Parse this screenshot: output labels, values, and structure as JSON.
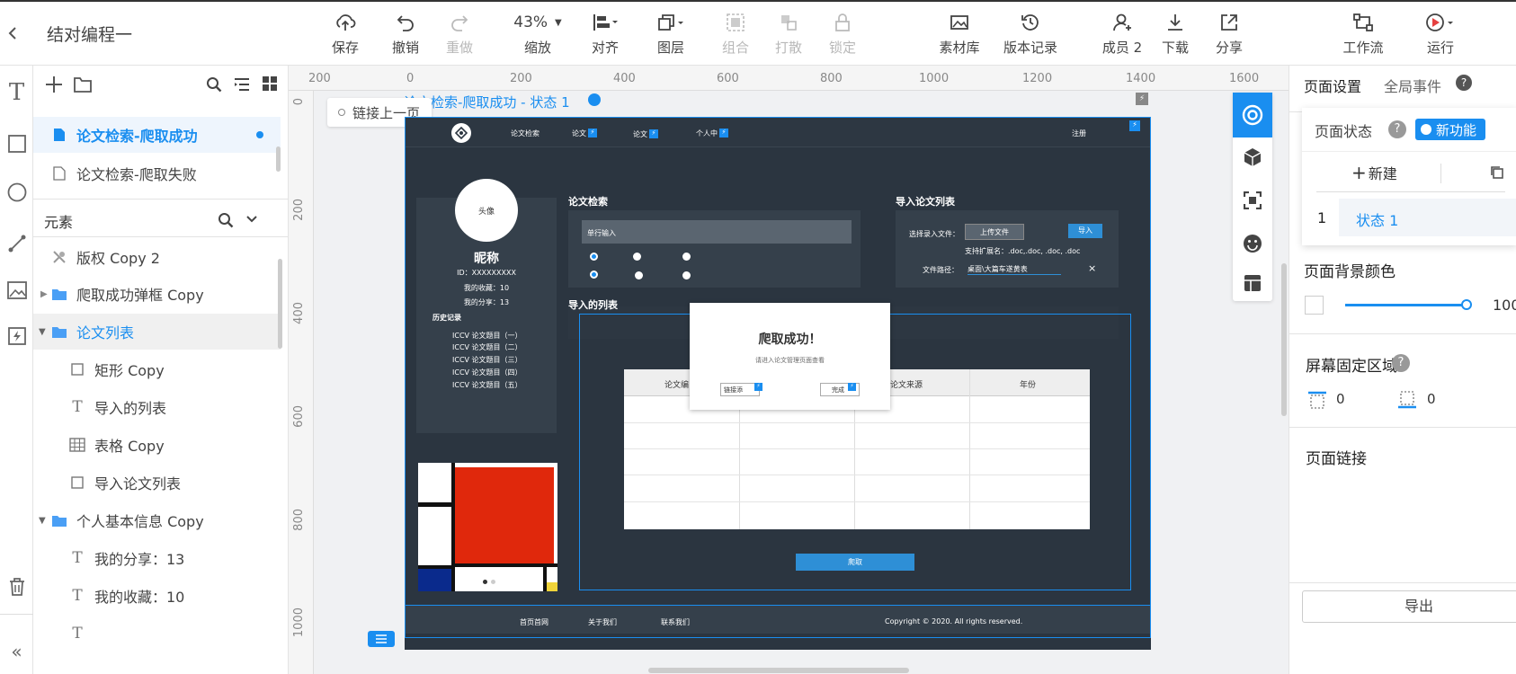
{
  "app": {
    "title": "结对编程一"
  },
  "toolbar": {
    "save": "保存",
    "undo": "撤销",
    "redo": "重做",
    "zoom": "43%",
    "zoom_label": "缩放",
    "align": "对齐",
    "layers": "图层",
    "group": "组合",
    "ungroup": "打散",
    "lock": "锁定",
    "assets": "素材库",
    "history": "版本记录",
    "members": "成员 2",
    "download": "下载",
    "share": "分享",
    "workflow": "工作流",
    "run": "运行"
  },
  "pages": [
    {
      "label": "论文检索-爬取成功",
      "active": true
    },
    {
      "label": "论文检索-爬取失败",
      "active": false
    }
  ],
  "elements_header": "元素",
  "tree": [
    {
      "label": "版权 Copy 2",
      "icon": "copyright-widget-icon"
    },
    {
      "label": "爬取成功弹框 Copy",
      "icon": "folder-icon"
    },
    {
      "label": "论文列表",
      "icon": "folder-icon"
    },
    {
      "label": "矩形 Copy",
      "icon": "rectangle-icon"
    },
    {
      "label": "导入的列表",
      "icon": "text-icon"
    },
    {
      "label": "表格 Copy",
      "icon": "table-icon"
    },
    {
      "label": "导入论文列表",
      "icon": "rectangle-icon"
    },
    {
      "label": "个人基本信息 Copy",
      "icon": "folder-icon"
    },
    {
      "label": "我的分享：13",
      "icon": "text-icon"
    },
    {
      "label": "我的收藏：10",
      "icon": "text-icon"
    }
  ],
  "ruler": {
    "top": [
      "200",
      "0",
      "200",
      "400",
      "600",
      "800",
      "1000",
      "1200",
      "1400",
      "1600"
    ],
    "left": [
      "0",
      "200",
      "400",
      "600",
      "800",
      "1000"
    ]
  },
  "canvas": {
    "state_label": "论文检索-爬取成功 - 状态 1",
    "link_prev": "链接上一页"
  },
  "mock": {
    "nav": [
      "论文检索",
      "论文",
      "论文",
      "个人中"
    ],
    "register": "注册",
    "avatar": "头像",
    "nickname": "昵称",
    "id": "ID：XXXXXXXXX",
    "favorites": "我的收藏：10",
    "shares": "我的分享：13",
    "history_title": "历史记录",
    "history": [
      "ICCV 论文题目（一）",
      "ICCV 论文题目（二）",
      "ICCV 论文题目（三）",
      "ICCV 论文题目（四）",
      "ICCV 论文题目（五）"
    ],
    "search_title": "论文检索",
    "search_placeholder": "单行输入",
    "import_title": "导入论文列表",
    "choose_file": "选择录入文件：",
    "upload": "上传文件",
    "import_btn": "导入",
    "ext": "支持扩展名：.doc,.doc, .doc, .doc",
    "path_label": "文件路径：",
    "path_value": "桌面\\大篇车遂黄表",
    "list_title": "导入的列表",
    "table_headers": [
      "论文编",
      "",
      "论文来源",
      "年份"
    ],
    "crawl_btn": "爬取",
    "popup_title": "爬取成功！",
    "popup_msg": "请进入论文管理页面查看",
    "popup_link": "链接添",
    "popup_done": "完成",
    "footer_links": [
      "首页首网",
      "关于我们",
      "联系我们"
    ],
    "copyright": "Copyright © 2020. All rights reserved."
  },
  "right": {
    "tab_page": "页面设置",
    "tab_events": "全局事件",
    "page_state": "页面状态",
    "new_feature": "新功能",
    "new_btn": "新建",
    "state_num": "1",
    "state_name": "状态 1",
    "bg_color": "页面背景颜色",
    "opacity": "100",
    "fixed_area": "屏幕固定区域",
    "fixed_top": "0",
    "fixed_bottom": "0",
    "page_link": "页面链接",
    "export": "导出"
  },
  "colors": {
    "accent": "#1a8ef0",
    "mock_bg": "#2b3540",
    "selection": "#1a8ef0"
  }
}
